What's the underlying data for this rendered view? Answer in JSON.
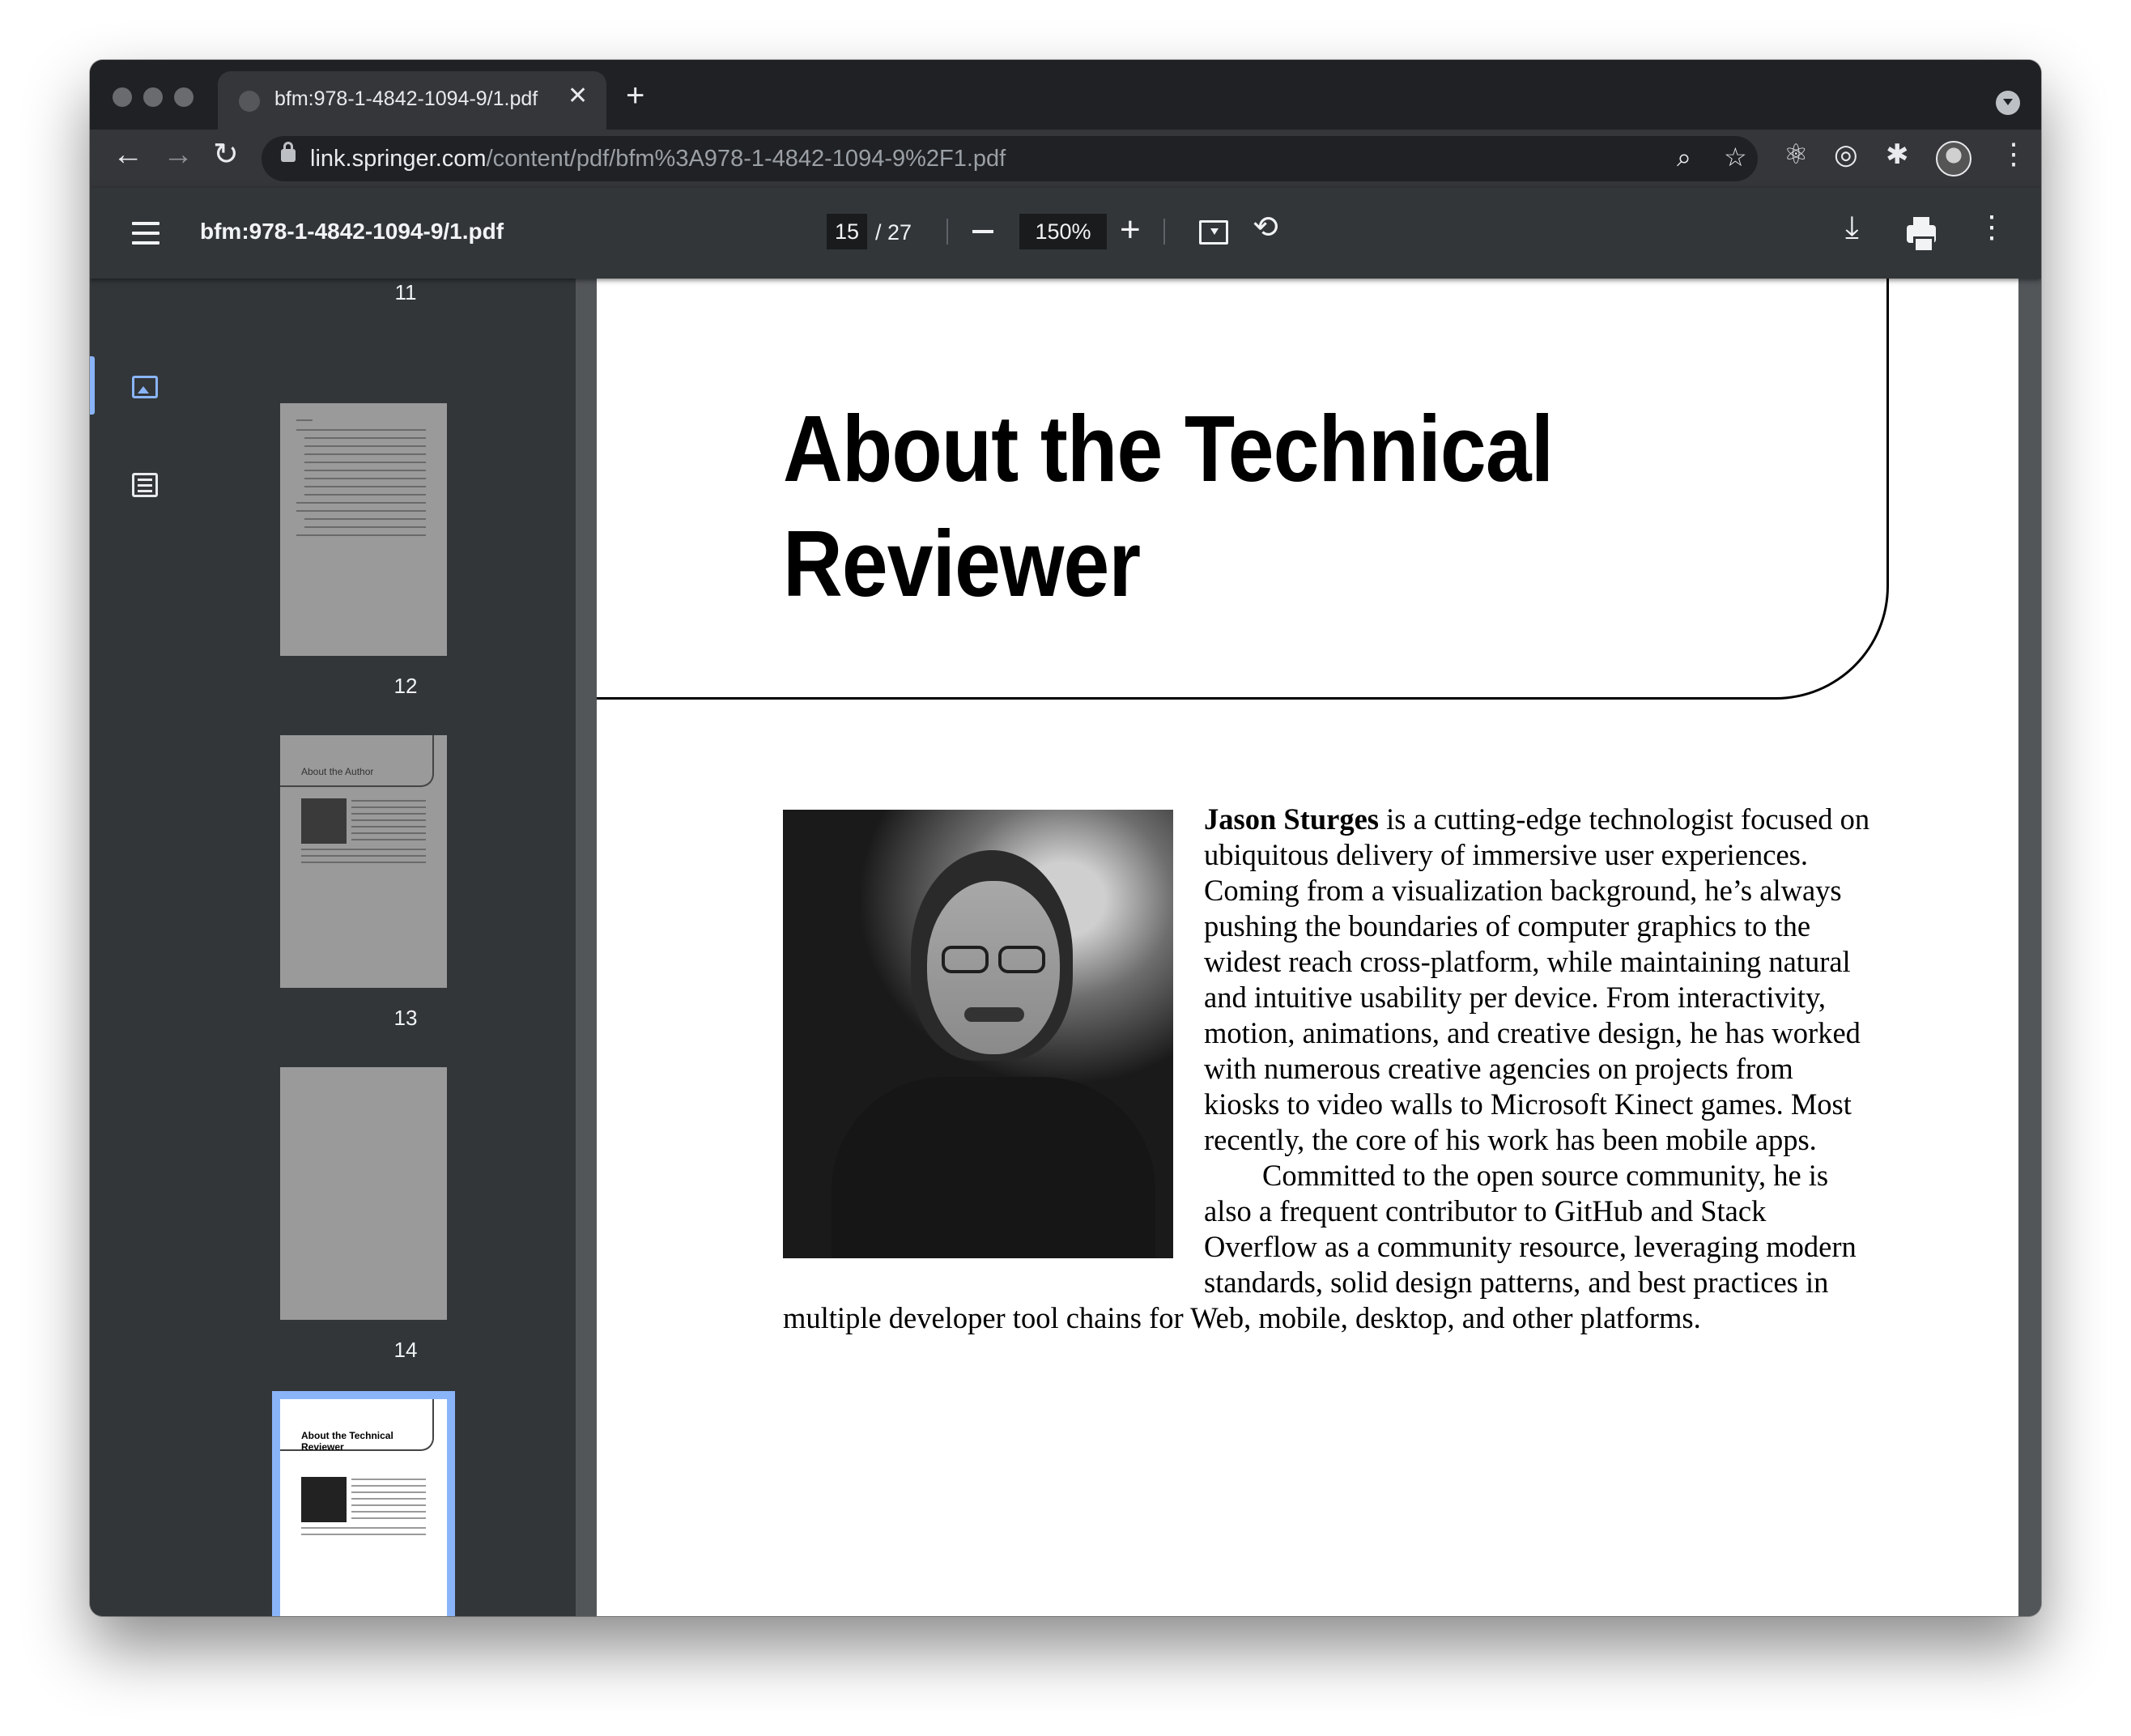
{
  "browser": {
    "tab_title": "bfm:978-1-4842-1094-9/1.pdf",
    "tab_close": "✕",
    "new_tab": "+",
    "url_host": "link.springer.com",
    "url_path": "/content/pdf/bfm%3A978-1-4842-1094-9%2F1.pdf",
    "back": "←",
    "forward": "→",
    "reload": "↻"
  },
  "icons": {
    "zoom": "⌕",
    "star": "☆",
    "react": "⚛",
    "target": "◎",
    "puzzle": "✱",
    "kebab": "⋮",
    "plus": "+",
    "rotate": "⟲",
    "download": "⤓"
  },
  "pdf_toolbar": {
    "title": "bfm:978-1-4842-1094-9/1.pdf",
    "current_page": "15",
    "page_total": "/ 27",
    "zoom": "150%"
  },
  "sidebar": {
    "page_labels": [
      "11",
      "12",
      "13",
      "14"
    ],
    "thumb_13_heading": "About the Author",
    "thumb_15_heading_1": "About the Technical",
    "thumb_15_heading_2": "Reviewer"
  },
  "document": {
    "title_line_1": "About the Technical",
    "title_line_2": "Reviewer",
    "bio_name": "Jason Sturges",
    "bio_paragraph_1": " is a cutting-edge technologist focused on ubiquitous delivery of immersive user experiences. Coming from a visualization background, he’s always pushing the boundaries of computer graphics to the widest reach cross-platform, while maintaining natural and intuitive usability per device. From interactivity, motion, animations, and creative design, he has worked with numerous creative agencies on projects from kiosks to video walls to Microsoft Kinect games. Most recently, the core of his work has been mobile apps.",
    "bio_paragraph_2": "Committed to the open source community, he is also a frequent contributor to GitHub and Stack Overflow as a community resource, leveraging modern standards, solid design patterns, and best practices in multiple developer tool chains for Web, mobile, desktop, and other platforms."
  },
  "colors": {
    "accent": "#8ab4f8",
    "toolbar": "#323639",
    "tabstrip": "#202124"
  }
}
